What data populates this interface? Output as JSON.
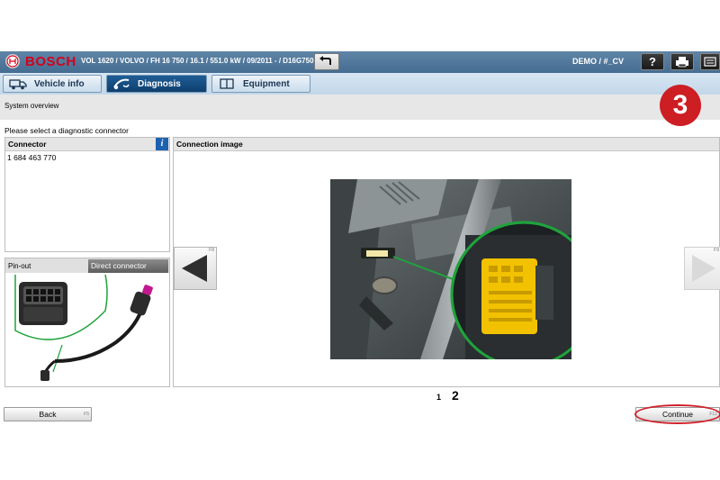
{
  "header": {
    "brand": "BOSCH",
    "vehicle_line": "VOL 1620 / VOLVO / FH 16 750 / 16.1 / 551.0 kW / 09/2011 - / D16G750",
    "mode": "DEMO / #_CV",
    "help_label": "?",
    "icons": [
      "bosch-logo-icon",
      "undo-arrow-icon",
      "help-icon",
      "print-icon",
      "menu-icon"
    ]
  },
  "tabs": [
    {
      "label": "Vehicle info",
      "icon": "truck-icon",
      "active": false
    },
    {
      "label": "Diagnosis",
      "icon": "stethoscope-icon",
      "active": true
    },
    {
      "label": "Equipment",
      "icon": "book-icon",
      "active": false
    }
  ],
  "subheader": {
    "title": "System overview"
  },
  "step_badge": "3",
  "instruction": "Please select a diagnostic connector",
  "connector_panel": {
    "title": "Connector",
    "info_label": "i",
    "items": [
      "1 684 463 770"
    ]
  },
  "pinout_panel": {
    "label": "Pin-out",
    "tab": "Direct connector"
  },
  "image_panel": {
    "title": "Connection image"
  },
  "pagination": {
    "pages": [
      "1",
      "2"
    ],
    "current": "2"
  },
  "buttons": {
    "back": "Back",
    "back_key": "F5",
    "continue": "Continue",
    "continue_key": "F12",
    "prev_key": "F8",
    "next_key": "F9"
  },
  "colors": {
    "header_blue": "#4f7599",
    "active_tab": "#0e3f6e",
    "brand_red": "#d4001a",
    "badge_red": "#cc1e23",
    "connector_yellow": "#f2c200",
    "callout_green": "#1fa33c"
  }
}
